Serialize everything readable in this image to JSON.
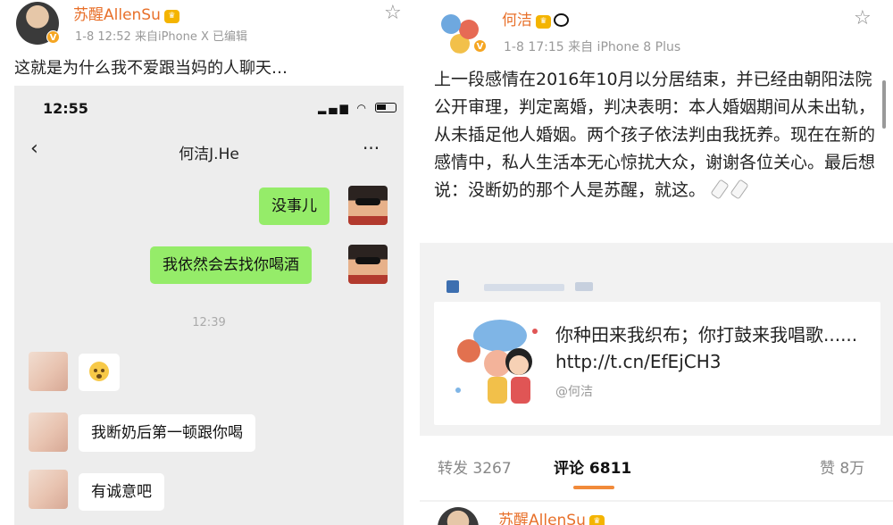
{
  "left": {
    "author": "苏醒AllenSu",
    "meta": "1-8 12:52  来自iPhone X  已编辑",
    "post_text": "这就是为什么我不爱跟当妈的人聊天…",
    "phone": {
      "clock": "12:55",
      "chat_title": "何洁J.He",
      "back_glyph": "‹",
      "more_glyph": "···",
      "messages_sent": [
        "没事儿",
        "我依然会去找你喝酒"
      ],
      "mid_time": "12:39",
      "messages_received": [
        "我断奶后第一顿跟你喝",
        "有诚意吧"
      ]
    }
  },
  "right": {
    "author": "何洁",
    "meta": "1-8 17:15  来自 iPhone 8 Plus",
    "body": "上一段感情在2016年10月以分居结束，并已经由朝阳法院公开审理，判定离婚，判决表明：本人婚姻期间从未出轨，从未插足他人婚姻。两个孩子依法判由我抚养。现在在新的感情中，私人生活本无心惊扰大众，谢谢各位关心。最后想说：没断奶的那个人是苏醒，就这。",
    "card": {
      "title": "你种田来我织布；你打鼓来我唱歌...... http://t.cn/EfEjCH3",
      "author": "@何洁"
    },
    "stats": {
      "repost_label": "转发",
      "repost_count": "3267",
      "comment_label": "评论",
      "comment_count": "6811",
      "like_label": "赞",
      "like_count": "8万"
    },
    "footer_author": "苏醒AllenSu"
  },
  "colors": {
    "username": "#e8702a",
    "wechat_green": "#95ec69",
    "tab_underline": "#f18a3a"
  },
  "icons": {
    "favorite": "star-outline-icon",
    "verified": "verified-v-icon",
    "member": "crown-icon"
  }
}
